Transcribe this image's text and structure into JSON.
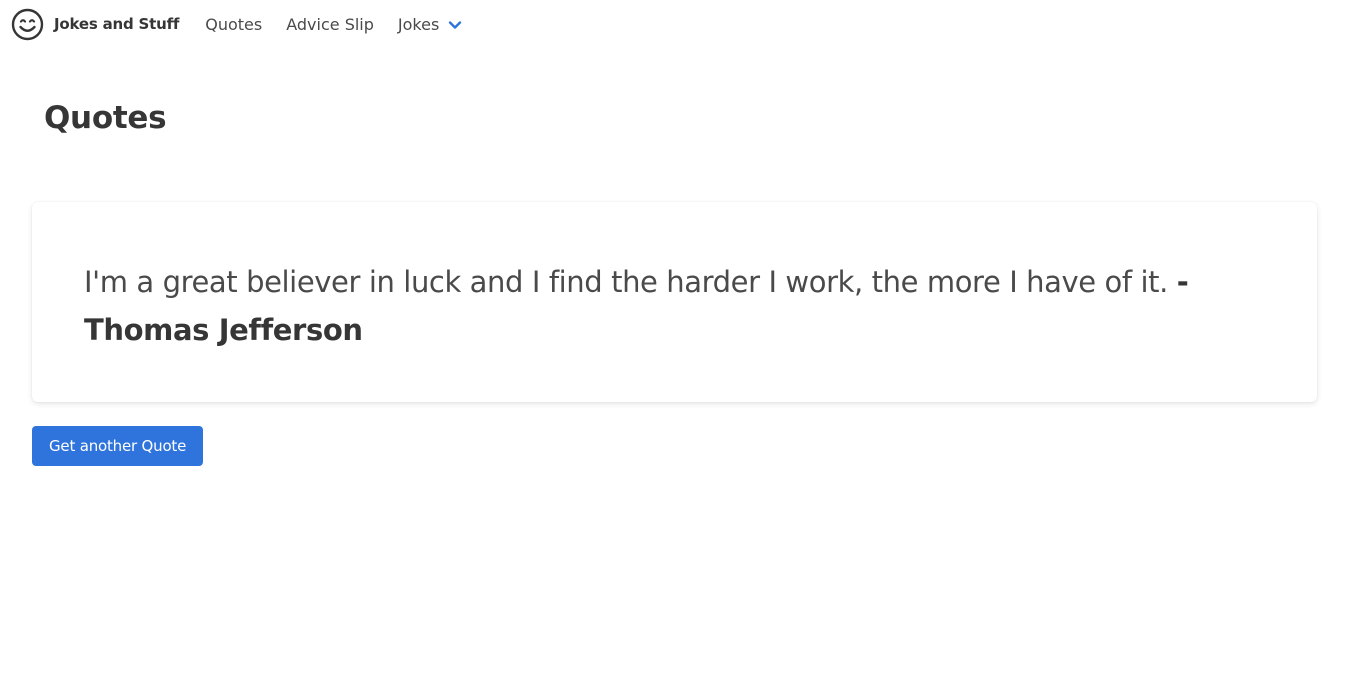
{
  "navbar": {
    "brand_icon": "smiley-face-icon",
    "brand_label": "Jokes and Stuff",
    "items": [
      {
        "label": "Quotes"
      },
      {
        "label": "Advice Slip"
      },
      {
        "label": "Jokes",
        "icon": "chevron-down-icon"
      }
    ],
    "accent_color": "#2f74dc"
  },
  "main": {
    "title": "Quotes",
    "quote": {
      "text": "I'm a great believer in luck and I find the harder I work, the more I have of it.",
      "separator": "-",
      "author": "Thomas Jefferson"
    },
    "button_label": "Get another Quote",
    "button_color": "#2f74dc"
  }
}
